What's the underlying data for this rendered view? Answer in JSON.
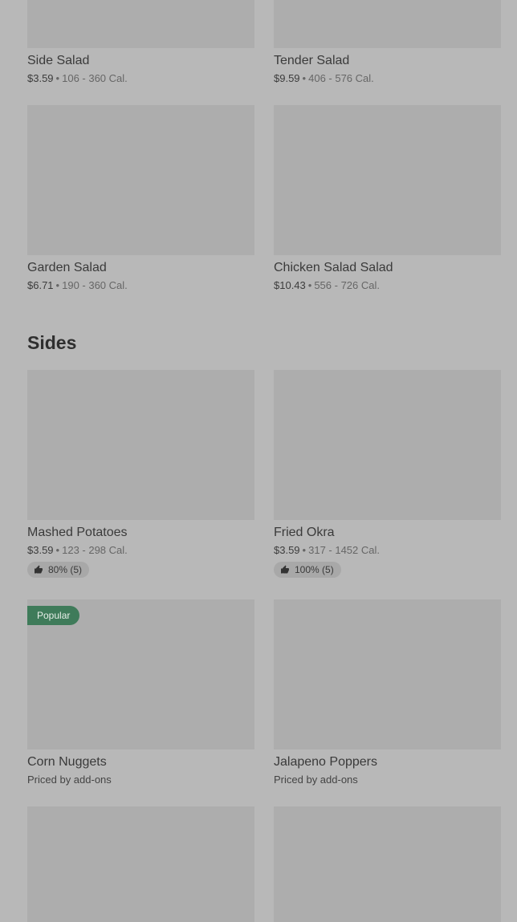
{
  "salads": [
    {
      "name": "Side Salad",
      "price": "$3.59",
      "calories": "106 - 360 Cal."
    },
    {
      "name": "Tender Salad",
      "price": "$9.59",
      "calories": "406 - 576 Cal."
    },
    {
      "name": "Garden Salad",
      "price": "$6.71",
      "calories": "190 - 360 Cal."
    },
    {
      "name": "Chicken Salad Salad",
      "price": "$10.43",
      "calories": "556 - 726 Cal."
    }
  ],
  "sides_section": {
    "title": "Sides"
  },
  "sides": [
    {
      "name": "Mashed Potatoes",
      "price": "$3.59",
      "calories": "123 - 298 Cal.",
      "rating": "80% (5)",
      "rating_icon": "thumbs-up-icon"
    },
    {
      "name": "Fried Okra",
      "price": "$3.59",
      "calories": "317 - 1452 Cal.",
      "rating": "100% (5)",
      "rating_icon": "thumbs-up-icon"
    },
    {
      "name": "Corn Nuggets",
      "badge": "Popular",
      "priced_label": "Priced by add-ons"
    },
    {
      "name": "Jalapeno Poppers",
      "priced_label": "Priced by add-ons"
    }
  ],
  "separator": "•",
  "colors": {
    "background": "#b8b8b8",
    "thumbnail": "#adadad",
    "badge_green": "#3f7b5a"
  }
}
